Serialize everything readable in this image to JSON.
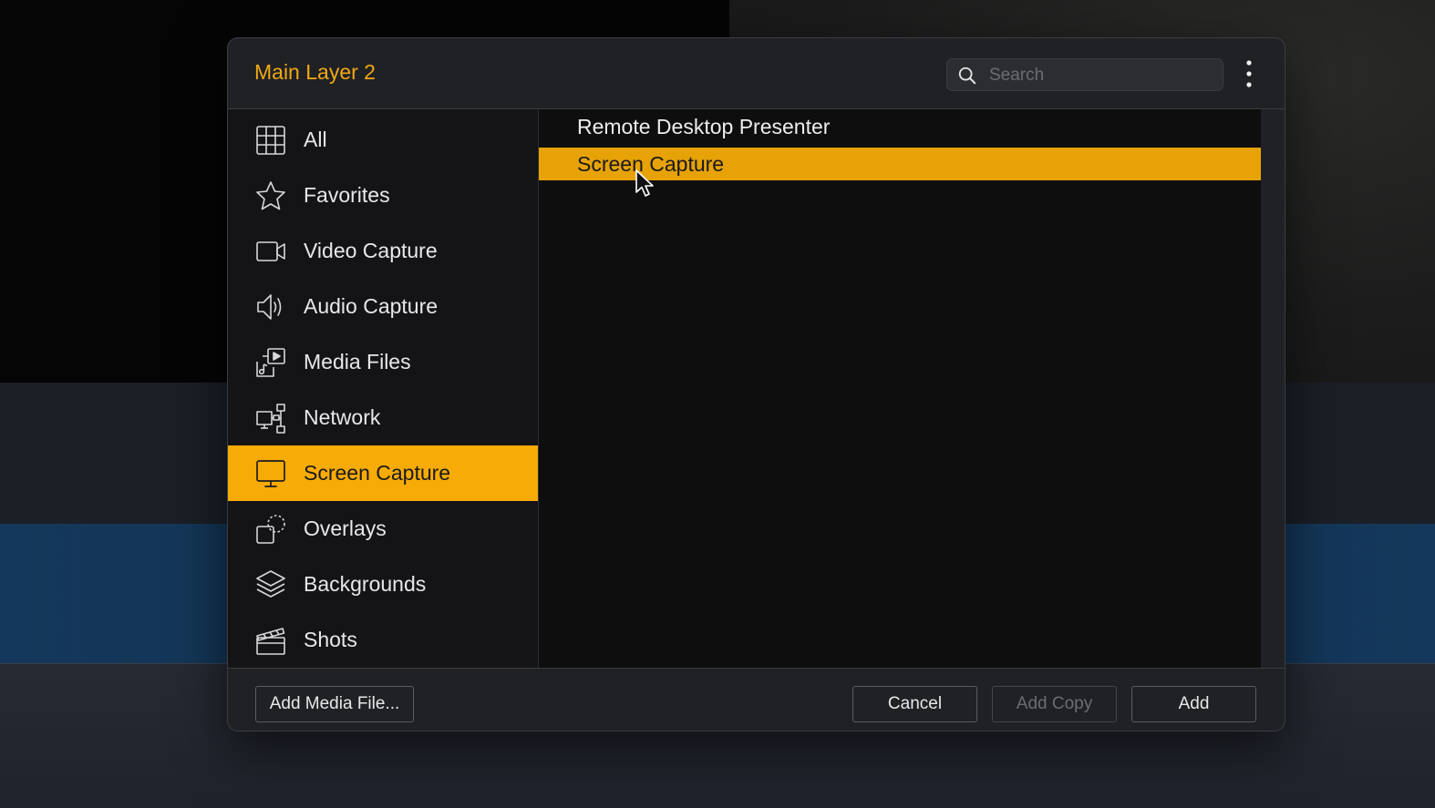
{
  "dialog": {
    "title": "Main Layer 2",
    "search": {
      "placeholder": "Search",
      "value": ""
    },
    "more_icon": "vertical-ellipsis-icon"
  },
  "sidebar": {
    "items": [
      {
        "label": "All",
        "icon": "grid-icon",
        "active": false
      },
      {
        "label": "Favorites",
        "icon": "star-icon",
        "active": false
      },
      {
        "label": "Video Capture",
        "icon": "video-camera-icon",
        "active": false
      },
      {
        "label": "Audio Capture",
        "icon": "speaker-icon",
        "active": false
      },
      {
        "label": "Media Files",
        "icon": "media-files-icon",
        "active": false
      },
      {
        "label": "Network",
        "icon": "network-icon",
        "active": false
      },
      {
        "label": "Screen Capture",
        "icon": "monitor-icon",
        "active": true
      },
      {
        "label": "Overlays",
        "icon": "overlay-icon",
        "active": false
      },
      {
        "label": "Backgrounds",
        "icon": "layers-icon",
        "active": false
      },
      {
        "label": "Shots",
        "icon": "clapperboard-icon",
        "active": false
      }
    ]
  },
  "content": {
    "items": [
      {
        "label": "Remote Desktop Presenter",
        "selected": false
      },
      {
        "label": "Screen Capture",
        "selected": true
      }
    ]
  },
  "footer": {
    "add_media_label": "Add Media File...",
    "cancel_label": "Cancel",
    "add_copy_label": "Add Copy",
    "add_label": "Add"
  },
  "colors": {
    "accent": "#f7ab06",
    "selection": "#e7a208",
    "title": "#f0a813"
  }
}
